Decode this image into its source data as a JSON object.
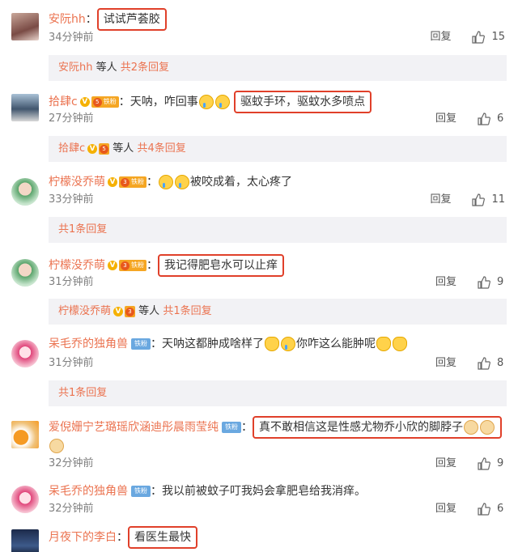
{
  "colors": {
    "username": "#eb7350",
    "time": "#808080",
    "highlight_box": "#e0402a",
    "reply_bg": "#f2f2f5"
  },
  "actions": {
    "reply_label": "回复"
  },
  "comments": [
    {
      "user": "安阮hh",
      "text": "试试芦荟胶",
      "time": "34分钟前",
      "likes": "15"
    },
    {
      "user": "拾肆c",
      "text_before": "：天呐，咋回事",
      "text": "驱蚊手环，驱蚊水多喷点",
      "time": "27分钟前",
      "likes": "6"
    },
    {
      "user": "柠檬没乔萌",
      "text": "被咬成着，太心疼了",
      "time": "33分钟前",
      "likes": "11"
    },
    {
      "user": "柠檬没乔萌",
      "text": "我记得肥皂水可以止痒",
      "time": "31分钟前",
      "likes": "9"
    },
    {
      "user": "呆毛乔的独角兽",
      "text_a": "：天呐这都肿成啥样了",
      "text_b": "你咋这么能肿呢",
      "time": "31分钟前",
      "likes": "8"
    },
    {
      "user": "爱倪姗宁艺璐瑶欣涵迪彤晨雨莹纯",
      "text": "真不敢相信这是性感尤物乔小欣的脚脖子",
      "time": "32分钟前",
      "likes": "9"
    },
    {
      "user": "呆毛乔的独角兽",
      "text": "：我以前被蚊子叮我妈会拿肥皂给我消痒。",
      "time": "32分钟前",
      "likes": "6"
    },
    {
      "user": "月夜下的李白",
      "text": "看医生最快"
    }
  ],
  "subs": [
    {
      "user": "安阮hh",
      "mid": "等人",
      "more": "共2条回复"
    },
    {
      "user": "拾肆c",
      "mid": "等人",
      "more": "共4条回复"
    },
    {
      "more": "共1条回复"
    },
    {
      "user": "柠檬没乔萌",
      "mid": "等人",
      "more": "共1条回复"
    },
    {
      "more": "共1条回复"
    }
  ],
  "badges": {
    "v": "V",
    "fan_label": "铁粉",
    "tie_label": "铁粉",
    "fan_level_5": "5",
    "fan_level_3": "3"
  }
}
